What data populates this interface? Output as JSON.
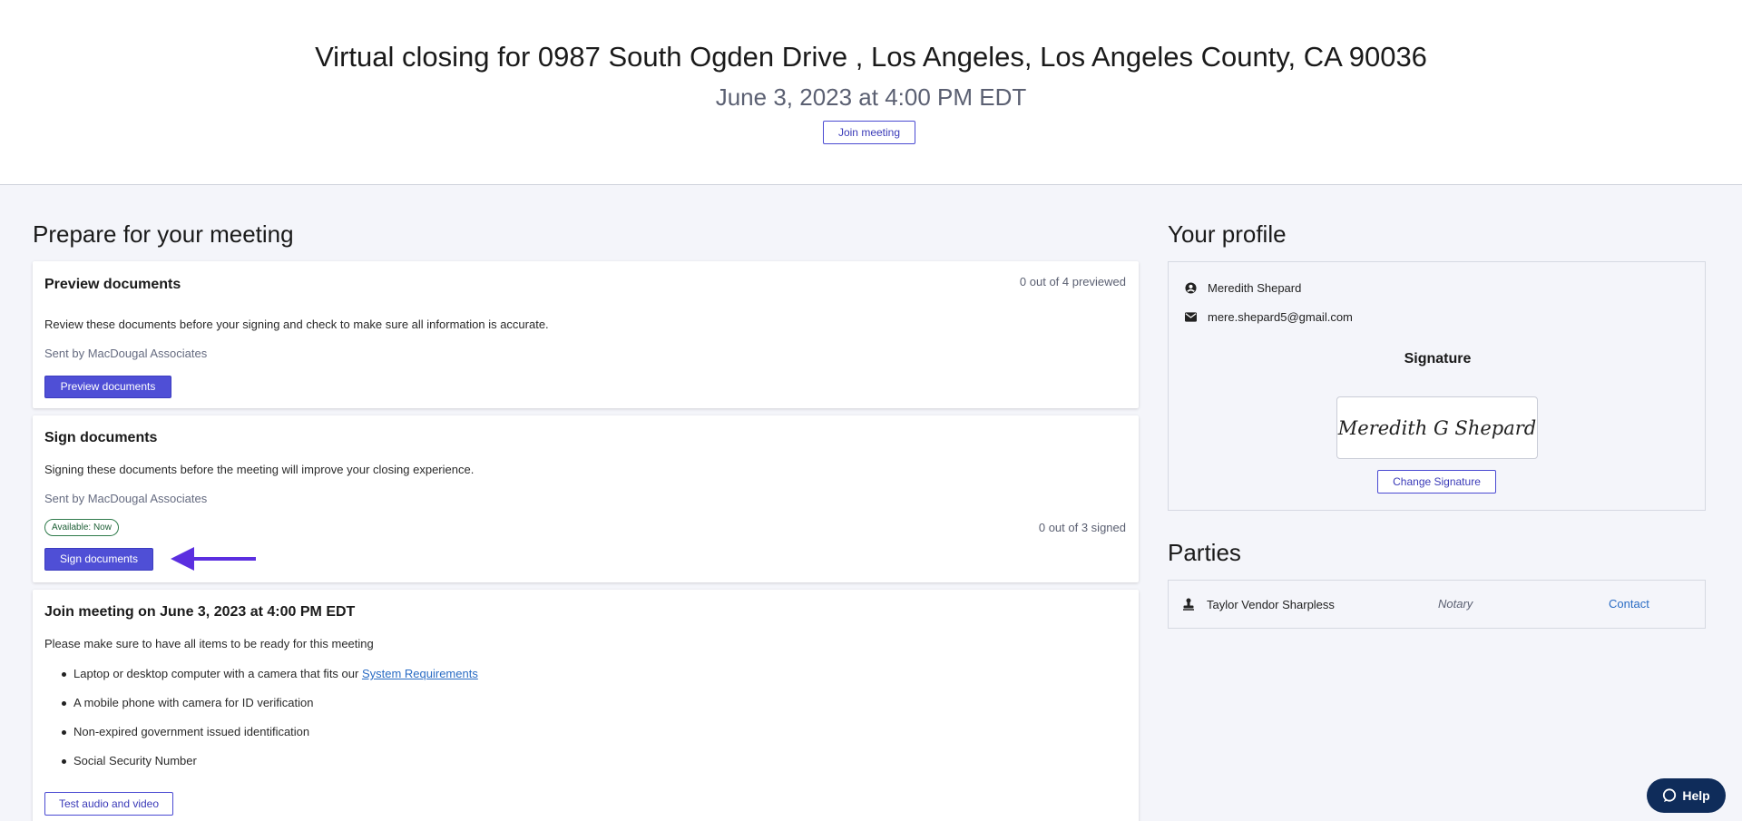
{
  "header": {
    "title": "Virtual closing for 0987 South Ogden Drive , Los Angeles, Los Angeles County, CA 90036",
    "datetime": "June 3, 2023 at 4:00 PM EDT",
    "join_button": "Join meeting"
  },
  "prepare": {
    "heading": "Prepare for your meeting",
    "preview": {
      "title": "Preview documents",
      "counter": "0 out of 4 previewed",
      "description": "Review these documents before your signing and check to make sure all information is accurate.",
      "sender": "Sent by MacDougal Associates",
      "button": "Preview documents"
    },
    "sign": {
      "title": "Sign documents",
      "description": "Signing these documents before the meeting will improve your closing experience.",
      "sender": "Sent by MacDougal Associates",
      "badge": "Available: Now",
      "counter": "0 out of 3 signed",
      "button": "Sign documents"
    },
    "join": {
      "title": "Join meeting on June 3, 2023 at 4:00 PM EDT",
      "description": "Please make sure to have all items to be ready for this meeting",
      "items": [
        {
          "text": "Laptop or desktop computer with a camera that fits our ",
          "link": "System Requirements"
        },
        {
          "text": "A mobile phone with camera for ID verification"
        },
        {
          "text": "Non-expired government issued identification"
        },
        {
          "text": "Social Security Number"
        }
      ],
      "test_button": "Test audio and video"
    }
  },
  "profile": {
    "heading": "Your profile",
    "name": "Meredith Shepard",
    "email": "mere.shepard5@gmail.com",
    "signature_label": "Signature",
    "signature_text": "Meredith G Shepard",
    "change_button": "Change Signature"
  },
  "parties": {
    "heading": "Parties",
    "items": [
      {
        "name": "Taylor Vendor Sharpless",
        "role": "Notary",
        "action": "Contact"
      }
    ]
  },
  "help": {
    "label": "Help"
  },
  "colors": {
    "accent": "#4f4fd6",
    "arrow": "#5b2fe0",
    "link": "#2a6cc4",
    "help_bg": "#0f2c5a"
  }
}
